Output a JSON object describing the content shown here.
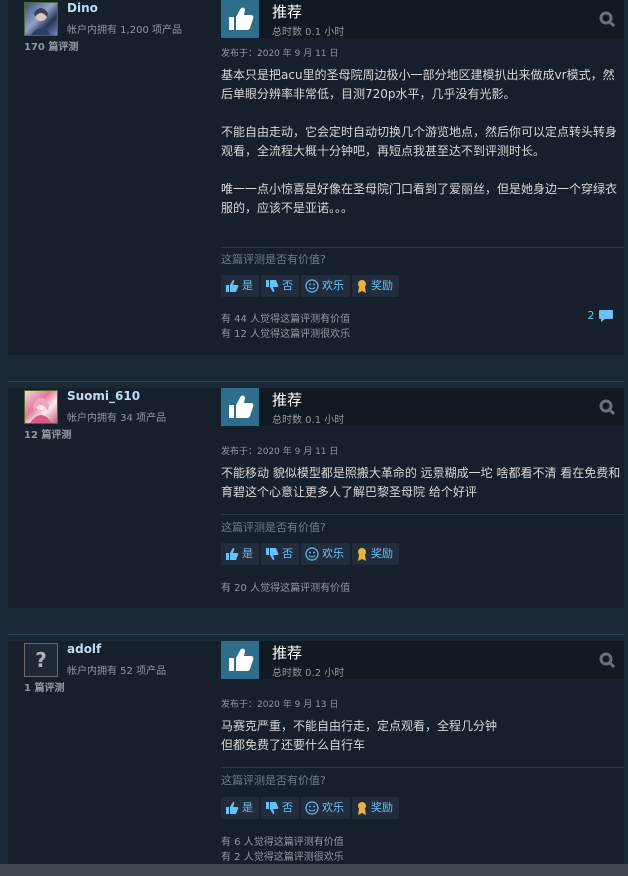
{
  "vote_prompt": "这篇评测是否有价值?",
  "buttons": {
    "yes": "是",
    "no": "否",
    "funny": "欢乐",
    "award": "奖励"
  },
  "reviews": [
    {
      "author": "Dino",
      "owned": "帐户内拥有 1,200 项产品",
      "review_count": "170 篇评测",
      "verdict": "推荐",
      "hours": "总时数 0.1 小时",
      "posted": "发布于：2020 年 9 月 11 日",
      "paragraphs": [
        "基本只是把acu里的圣母院周边极小一部分地区建模扒出来做成vr模式，然后单眼分辨率非常低，目测720p水平，几乎没有光影。",
        "不能自由走动，它会定时自动切换几个游览地点，然后你可以定点转头转身观看，全流程大概十分钟吧，再短点我甚至达不到评测时长。",
        "",
        "唯一一点小惊喜是好像在圣母院门口看到了爱丽丝，但是她身边一个穿绿衣服的，应该不是亚诺。。。"
      ],
      "helpful": "有 44 人觉得这篇评测有价值",
      "funny": "有 12 人觉得这篇评测很欢乐",
      "comments": "2"
    },
    {
      "author": "Suomi_610",
      "owned": "帐户内拥有 34 项产品",
      "review_count": "12 篇评测",
      "verdict": "推荐",
      "hours": "总时数 0.1 小时",
      "posted": "发布于：2020 年 9 月 11 日",
      "paragraphs": [
        "不能移动 貌似模型都是照搬大革命的 远景糊成一坨 啥都看不清 看在免费和育碧这个心意让更多人了解巴黎圣母院 给个好评"
      ],
      "helpful": "有 20 人觉得这篇评测有价值",
      "funny": "",
      "comments": ""
    },
    {
      "author": "adolf",
      "owned": "帐户内拥有 52 项产品",
      "review_count": "1 篇评测",
      "verdict": "推荐",
      "hours": "总时数 0.2 小时",
      "posted": "发布于：2020 年 9 月 13 日",
      "paragraphs": [
        "马赛克严重，不能自由行走，定点观看，全程几分钟\n但都免费了还要什么自行车"
      ],
      "helpful": "有 6 人觉得这篇评测有价值",
      "funny": "有 2 人觉得这篇评测很欢乐",
      "comments": ""
    }
  ]
}
